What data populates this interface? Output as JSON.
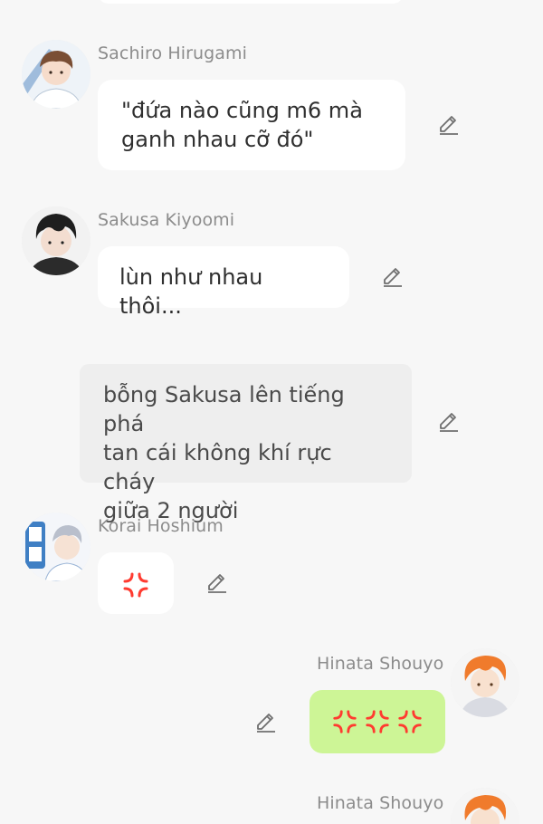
{
  "messages": [
    {
      "sender": "Sachiro Hirugami",
      "text": "\"đứa nào cũng m6 mà\nganh nhau cỡ đó\""
    },
    {
      "sender": "Sakusa Kiyoomi",
      "text": "lùn như nhau thôi..."
    },
    {
      "type": "narration",
      "text": "bỗng Sakusa lên tiếng phá\ntan cái không khí rực cháy\ngiữa 2 người"
    },
    {
      "sender": "Korai Hoshium",
      "icons": [
        "anger-icon"
      ]
    },
    {
      "sender": "Hinata Shouyo",
      "icons": [
        "anger-icon",
        "anger-icon",
        "anger-icon"
      ]
    },
    {
      "sender": "Hinata Shouyo"
    }
  ],
  "icons": {
    "edit": "pencil-edit-icon",
    "anger": "anger-icon"
  },
  "colors": {
    "background": "#f7f7f7",
    "bubble": "#ffffff",
    "narration": "#eeeeee",
    "self_bubble": "#cdf596",
    "anger": "#ff3b30",
    "name": "#8c8c8c"
  }
}
